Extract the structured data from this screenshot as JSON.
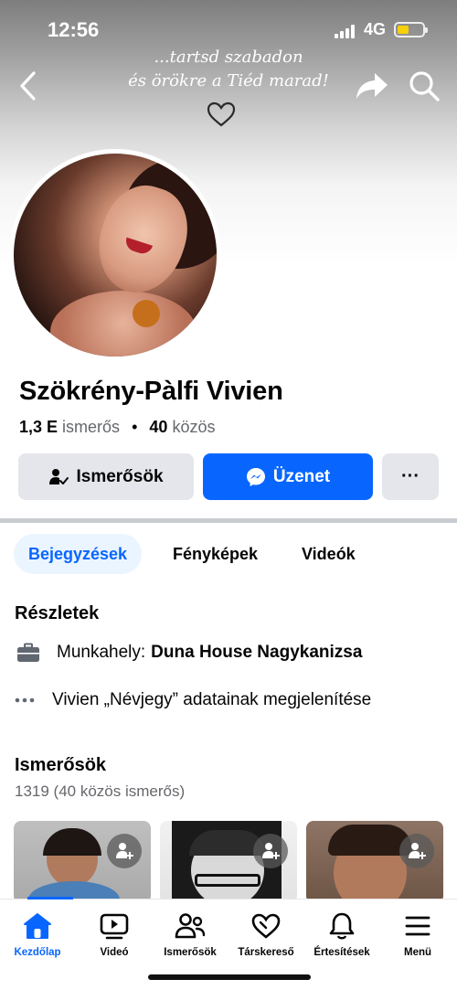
{
  "status_bar": {
    "time": "12:56",
    "network": "4G"
  },
  "cover": {
    "line1": "...tartsd szabadon",
    "line2": "és örökre a Tiéd marad!"
  },
  "profile": {
    "name": "Szökrény-Pàlfi Vivien",
    "friends_count": "1,3 E",
    "friends_label": "ismerős",
    "mutual_count": "40",
    "mutual_label": "közös"
  },
  "actions": {
    "friends_label": "Ismerősök",
    "message_label": "Üzenet",
    "more_label": "···"
  },
  "tabs": [
    {
      "label": "Bejegyzések",
      "active": true
    },
    {
      "label": "Fényképek",
      "active": false
    },
    {
      "label": "Videók",
      "active": false
    }
  ],
  "details": {
    "title": "Részletek",
    "work_prefix": "Munkahely:",
    "work_place": "Duna House Nagykanizsa",
    "about_link": "Vivien „Névjegy” adatainak megjelenítése"
  },
  "friends": {
    "title": "Ismerősök",
    "subtitle": "1319 (40 közös ismerős)"
  },
  "bottom_nav": [
    {
      "label": "Kezdőlap",
      "icon": "home-icon",
      "active": true
    },
    {
      "label": "Videó",
      "icon": "video-icon",
      "active": false
    },
    {
      "label": "Ismerősök",
      "icon": "friends-icon",
      "active": false
    },
    {
      "label": "Társkereső",
      "icon": "dating-heart-icon",
      "active": false
    },
    {
      "label": "Értesítések",
      "icon": "bell-icon",
      "active": false
    },
    {
      "label": "Menü",
      "icon": "menu-icon",
      "active": false
    }
  ],
  "colors": {
    "accent": "#0866ff",
    "button_gray": "#e4e6eb",
    "secondary_text": "#65676b"
  }
}
